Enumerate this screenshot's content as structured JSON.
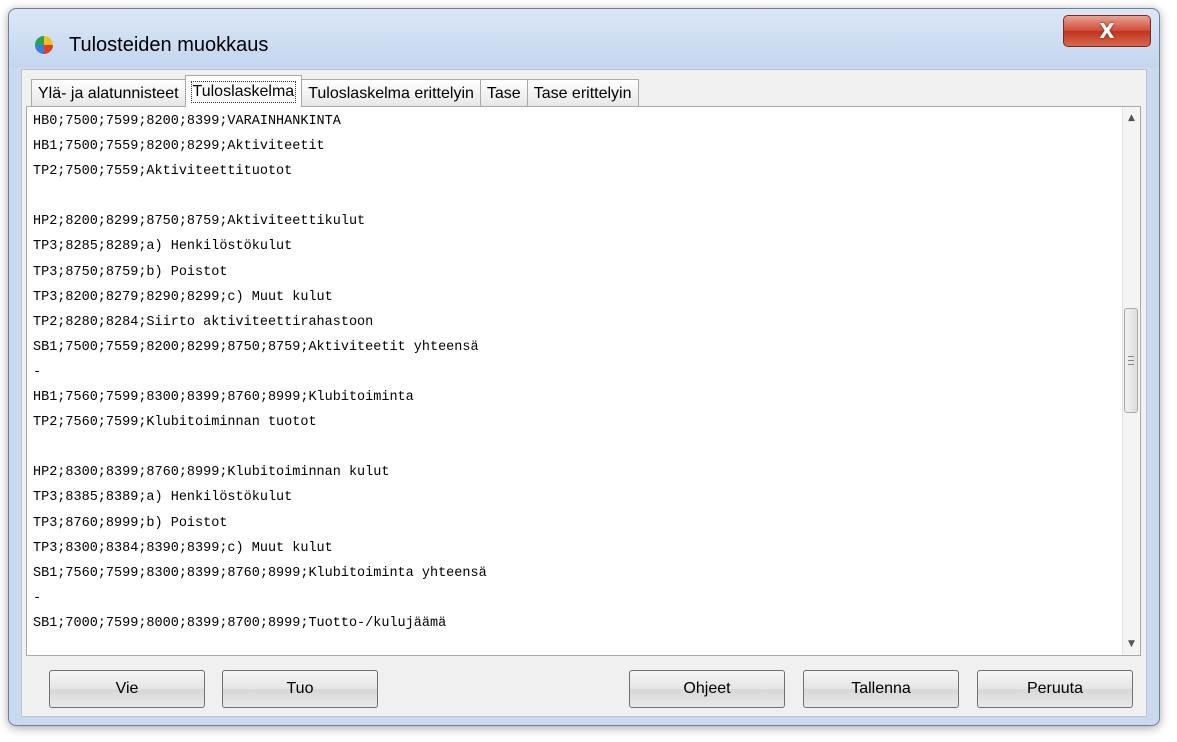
{
  "window": {
    "title": "Tulosteiden muokkaus",
    "close_glyph": "X"
  },
  "tabs": [
    {
      "label": "Ylä- ja alatunnisteet",
      "active": false
    },
    {
      "label": "Tuloslaskelma",
      "active": true
    },
    {
      "label": "Tuloslaskelma erittelyin",
      "active": false
    },
    {
      "label": "Tase",
      "active": false
    },
    {
      "label": "Tase erittelyin",
      "active": false
    }
  ],
  "editor": {
    "lines": [
      "HB0;7500;7599;8200;8399;VARAINHANKINTA",
      "HB1;7500;7559;8200;8299;Aktiviteetit",
      "TP2;7500;7559;Aktiviteettituotot",
      "",
      "HP2;8200;8299;8750;8759;Aktiviteettikulut",
      "TP3;8285;8289;a) Henkilöstökulut",
      "TP3;8750;8759;b) Poistot",
      "TP3;8200;8279;8290;8299;c) Muut kulut",
      "TP2;8280;8284;Siirto aktiviteettirahastoon",
      "SB1;7500;7559;8200;8299;8750;8759;Aktiviteetit yhteensä",
      "-",
      "HB1;7560;7599;8300;8399;8760;8999;Klubitoiminta",
      "TP2;7560;7599;Klubitoiminnan tuotot",
      "",
      "HP2;8300;8399;8760;8999;Klubitoiminnan kulut",
      "TP3;8385;8389;a) Henkilöstökulut",
      "TP3;8760;8999;b) Poistot",
      "TP3;8300;8384;8390;8399;c) Muut kulut",
      "SB1;7560;7599;8300;8399;8760;8999;Klubitoiminta yhteensä",
      "-",
      "SB1;7000;7599;8000;8399;8700;8999;Tuotto-/kulujäämä"
    ],
    "scroll_position": 0.45
  },
  "buttons": {
    "export": "Vie",
    "import": "Tuo",
    "help": "Ohjeet",
    "save": "Tallenna",
    "cancel": "Peruuta"
  },
  "colors": {
    "title_bar": "#c3d6ee",
    "close_button": "#c0321e",
    "dialog_background": "#f0f0f0"
  }
}
